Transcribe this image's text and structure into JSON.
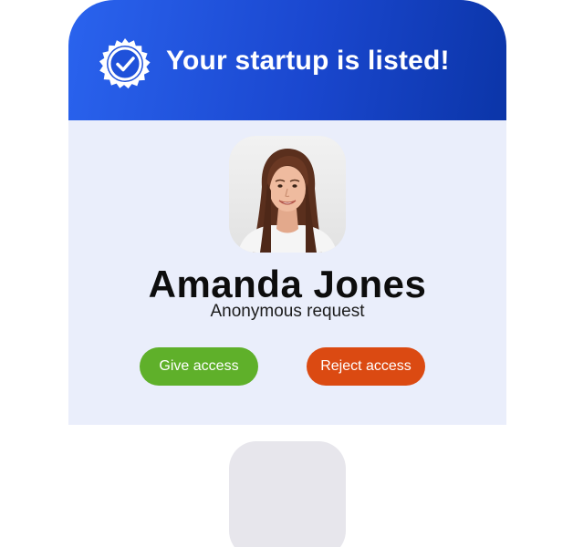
{
  "header": {
    "title": "Your startup is listed!",
    "badge_icon": "verified-badge-icon",
    "gradient_colors": [
      "#2a63ee",
      "#0b35a8"
    ]
  },
  "profile": {
    "name": "Amanda Jones",
    "subtitle": "Anonymous request",
    "avatar": "woman-portrait"
  },
  "actions": {
    "give_label": "Give access",
    "give_color": "#5fb02a",
    "reject_label": "Reject access",
    "reject_color": "#db4a12"
  },
  "colors": {
    "body_background": "#eaeefb",
    "placeholder": "#e7e6ec"
  }
}
